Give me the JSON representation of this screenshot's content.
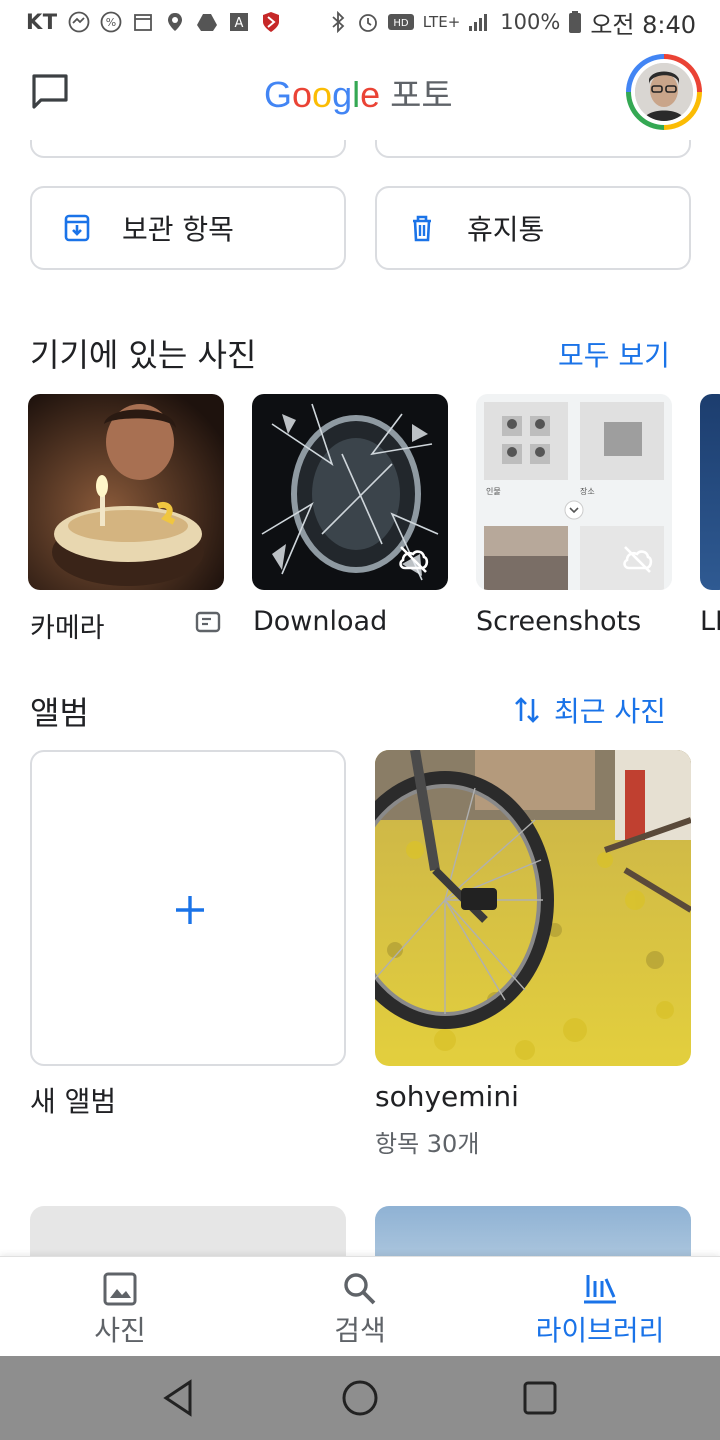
{
  "status_bar": {
    "carrier": "KT",
    "network": "LTE+",
    "battery": "100%",
    "time": "오전 8:40",
    "icons": [
      "speed-icon",
      "percent-icon",
      "calendar-icon",
      "location-icon",
      "drive-icon",
      "a-icon",
      "shield-icon",
      "bluetooth-icon",
      "alarm-icon",
      "hd-icon",
      "signal-icon",
      "battery-icon"
    ]
  },
  "app_bar": {
    "logo_letters": [
      "G",
      "o",
      "o",
      "g",
      "l",
      "e"
    ],
    "logo_suffix": "포토",
    "chat_icon": "chat-icon",
    "avatar": "account-avatar"
  },
  "utilities": [
    {
      "label": "보관 항목",
      "icon": "archive-icon"
    },
    {
      "label": "휴지통",
      "icon": "trash-icon"
    }
  ],
  "device_photos": {
    "title": "기기에 있는 사진",
    "view_all": "모두 보기",
    "folders": [
      {
        "label": "카메라",
        "badge_icon": "backup-status-icon"
      },
      {
        "label": "Download",
        "cloud_off": true
      },
      {
        "label": "Screenshots",
        "cloud_off": true
      },
      {
        "label": "LI",
        "cloud_off": false
      }
    ],
    "screenshot_thumb_labels": [
      "인물",
      "장소"
    ]
  },
  "albums": {
    "title": "앨범",
    "sort_label": "최근 사진",
    "new_album_label": "새 앨범",
    "items": [
      {
        "name": "sohyemini",
        "count": "항목 30개"
      }
    ]
  },
  "bottom_nav": {
    "items": [
      {
        "label": "사진",
        "icon": "photo-icon",
        "active": false
      },
      {
        "label": "검색",
        "icon": "search-icon",
        "active": false
      },
      {
        "label": "라이브러리",
        "icon": "library-icon",
        "active": true
      }
    ]
  },
  "colors": {
    "accent": "#1a73e8",
    "border": "#dadce0",
    "text": "#202124",
    "secondary": "#5f6368",
    "system_nav": "#8e8e8e"
  }
}
